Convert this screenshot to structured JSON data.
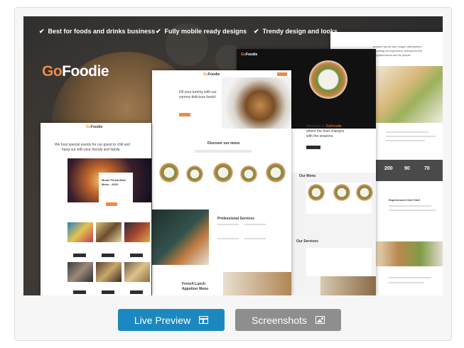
{
  "features": [
    {
      "text": "Best for foods and drinks business"
    },
    {
      "text": "Fully mobile ready designs"
    },
    {
      "text": "Trendy design and looks"
    }
  ],
  "logo": {
    "prefix": "Go",
    "suffix": "Foodie"
  },
  "screens": {
    "left": {
      "logo_prefix": "Go",
      "logo_suffix": "Foodie",
      "intro": "We host special events for our guest to chill and",
      "intro2": "hang out with your friends and family.",
      "event_title": "Music Fiesta Beat",
      "event_title2": "Menu - 2020"
    },
    "center": {
      "logo_prefix": "Go",
      "logo_suffix": "Foodie",
      "hero": "Fill your tummy with our",
      "hero2": "yummy delicious foods!",
      "menu_heading": "Discover our menu",
      "services_heading": "Professional Services",
      "lunch_line1": "French Lunch",
      "lunch_line2": "Appetizer Menu"
    },
    "dark": {
      "logo_prefix": "Go",
      "logo_suffix": "Foodie",
      "welcome": "Welcome to",
      "brand": "GoFoodie",
      "tag1": "where the food changes",
      "tag2": "with the seasons.",
      "menu_heading": "Our Menu",
      "services_heading": "Our Services"
    },
    "right": {
      "text1": "brands has its own unique atmosphere",
      "text2": "providing an experience relevant to the",
      "text3": "neighbourhood and its people.",
      "stats": [
        "200",
        "90",
        "70"
      ],
      "chef": "Experienced Chef Chef"
    }
  },
  "buttons": {
    "live_preview": "Live Preview",
    "screenshots": "Screenshots"
  },
  "colors": {
    "accent": "#ec8a4a",
    "live_button": "#1b89bf",
    "screenshots_button": "#8e8e8e"
  }
}
